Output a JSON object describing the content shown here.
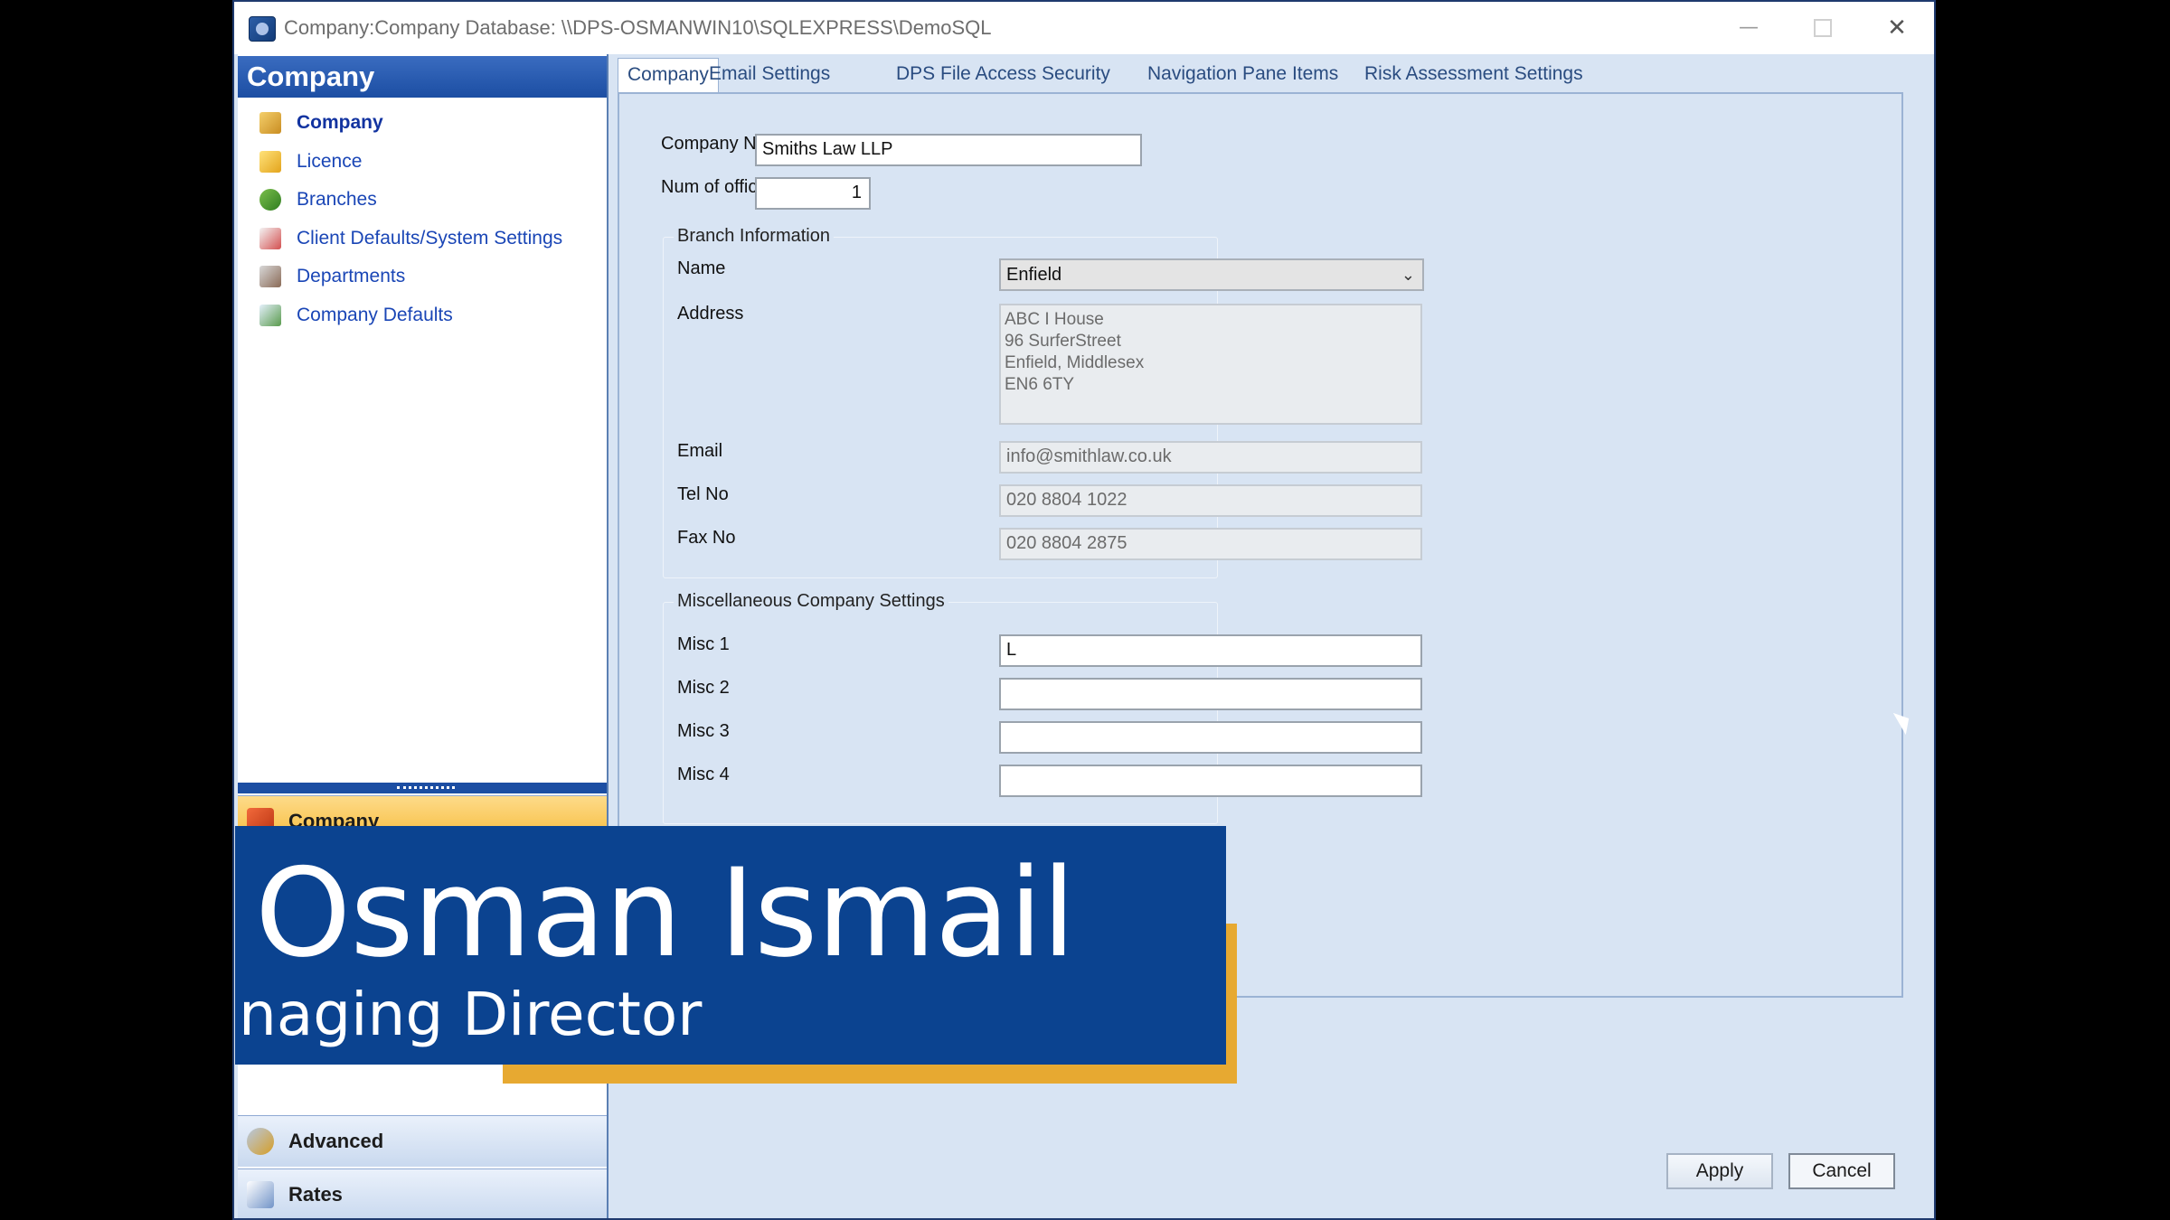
{
  "window": {
    "title": "Company:Company Database: \\\\DPS-OSMANWIN10\\SQLEXPRESS\\DemoSQL",
    "minimize": "—",
    "close": "✕"
  },
  "nav": {
    "header": "Company",
    "items": [
      {
        "label": "Company",
        "icon": "company-icon",
        "active": true
      },
      {
        "label": "Licence",
        "icon": "licence-icon"
      },
      {
        "label": "Branches",
        "icon": "branches-icon"
      },
      {
        "label": "Client Defaults/System Settings",
        "icon": "client-defaults-icon"
      },
      {
        "label": "Departments",
        "icon": "departments-icon"
      },
      {
        "label": "Company Defaults",
        "icon": "company-defaults-icon"
      }
    ],
    "buttons": {
      "company": "Company",
      "advanced": "Advanced",
      "rates": "Rates"
    },
    "chevron": "»"
  },
  "tabs": [
    "Company",
    "Email Settings",
    "DPS File Access Security",
    "Navigation Pane Items",
    "Risk Assessment Settings"
  ],
  "form": {
    "company_name_label": "Company Name",
    "company_name": "Smiths Law LLP",
    "num_offices_label": "Num of offices",
    "num_offices": "1",
    "branch": {
      "title": "Branch Information",
      "name_label": "Name",
      "name": "Enfield",
      "address_label": "Address",
      "address_lines": [
        "ABC I House",
        "96 SurferStreet",
        "Enfield, Middlesex",
        "EN6 6TY"
      ],
      "email_label": "Email",
      "email": "info@smithlaw.co.uk",
      "tel_label": "Tel No",
      "tel": "020 8804 1022",
      "fax_label": "Fax No",
      "fax": "020 8804 2875"
    },
    "misc": {
      "title": "Miscellaneous Company Settings",
      "fields": [
        {
          "label": "Misc 1",
          "value": "L"
        },
        {
          "label": "Misc 2",
          "value": ""
        },
        {
          "label": "Misc 3",
          "value": ""
        },
        {
          "label": "Misc 4",
          "value": ""
        }
      ]
    }
  },
  "buttons": {
    "apply": "Apply",
    "cancel": "Cancel"
  },
  "overlay": {
    "name": "Osman Ismail",
    "role": "naging Director"
  },
  "colors": {
    "overlay_blue": "#0b4390",
    "overlay_gold": "#e7a931",
    "nav_header": "#1c4ea3"
  }
}
